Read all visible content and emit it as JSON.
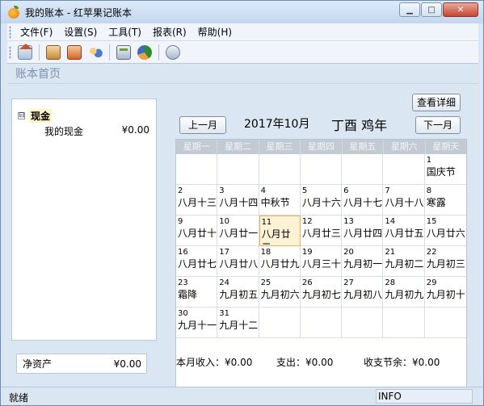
{
  "window": {
    "title": "我的账本 - 红苹果记账本"
  },
  "menu": [
    "文件(F)",
    "设置(S)",
    "工具(T)",
    "报表(R)",
    "帮助(H)"
  ],
  "toolbar": {
    "icons": [
      "home-icon",
      "account-book-icon",
      "ledger-icon",
      "users-icon",
      "calculator-icon",
      "pie-chart-icon",
      "chat-icon"
    ]
  },
  "section_title": "账本首页",
  "accounts": {
    "group_label": "现金",
    "toggle": "⊟",
    "item_label": "我的现金",
    "item_value": "¥0.00",
    "net_label": "净资产",
    "net_value": "¥0.00"
  },
  "calendar": {
    "detail_button": "查看详细",
    "prev_button": "上一月",
    "next_button": "下一月",
    "month": "2017年10月",
    "ganzhi": "丁酉  鸡年",
    "weekdays": [
      "星期一",
      "星期二",
      "星期三",
      "星期四",
      "星期五",
      "星期六",
      "星期天"
    ],
    "today": "11",
    "days": [
      {
        "d": "",
        "l": ""
      },
      {
        "d": "",
        "l": ""
      },
      {
        "d": "",
        "l": ""
      },
      {
        "d": "",
        "l": ""
      },
      {
        "d": "",
        "l": ""
      },
      {
        "d": "",
        "l": ""
      },
      {
        "d": "1",
        "l": "国庆节"
      },
      {
        "d": "2",
        "l": "八月十三"
      },
      {
        "d": "3",
        "l": "八月十四"
      },
      {
        "d": "4",
        "l": "中秋节"
      },
      {
        "d": "5",
        "l": "八月十六"
      },
      {
        "d": "6",
        "l": "八月十七"
      },
      {
        "d": "7",
        "l": "八月十八"
      },
      {
        "d": "8",
        "l": "寒露"
      },
      {
        "d": "9",
        "l": "八月廿十"
      },
      {
        "d": "10",
        "l": "八月廿一"
      },
      {
        "d": "11",
        "l": "八月廿二"
      },
      {
        "d": "12",
        "l": "八月廿三"
      },
      {
        "d": "13",
        "l": "八月廿四"
      },
      {
        "d": "14",
        "l": "八月廿五"
      },
      {
        "d": "15",
        "l": "八月廿六"
      },
      {
        "d": "16",
        "l": "八月廿七"
      },
      {
        "d": "17",
        "l": "八月廿八"
      },
      {
        "d": "18",
        "l": "八月廿九"
      },
      {
        "d": "19",
        "l": "八月三十"
      },
      {
        "d": "20",
        "l": "九月初一"
      },
      {
        "d": "21",
        "l": "九月初二"
      },
      {
        "d": "22",
        "l": "九月初三"
      },
      {
        "d": "23",
        "l": "霜降"
      },
      {
        "d": "24",
        "l": "九月初五"
      },
      {
        "d": "25",
        "l": "九月初六"
      },
      {
        "d": "26",
        "l": "九月初七"
      },
      {
        "d": "27",
        "l": "九月初八"
      },
      {
        "d": "28",
        "l": "九月初九"
      },
      {
        "d": "29",
        "l": "九月初十"
      },
      {
        "d": "30",
        "l": "九月十一"
      },
      {
        "d": "31",
        "l": "九月十二"
      },
      {
        "d": "",
        "l": ""
      },
      {
        "d": "",
        "l": ""
      },
      {
        "d": "",
        "l": ""
      },
      {
        "d": "",
        "l": ""
      },
      {
        "d": "",
        "l": ""
      }
    ]
  },
  "summary": {
    "income": "本月收入：¥0.00",
    "expense": "支出：¥0.00",
    "balance": "收支节余：¥0.00"
  },
  "status": {
    "left": "就绪",
    "right": "INFO"
  }
}
